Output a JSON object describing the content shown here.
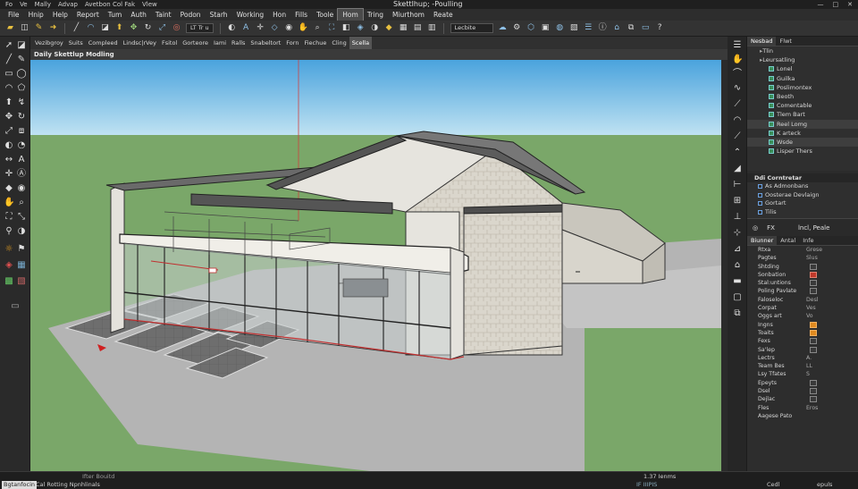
{
  "titlebar": {
    "menu": [
      "Fo",
      "Ve",
      "Mally",
      "Advap",
      "Avetbon Col Fak",
      "Vlew"
    ],
    "title": "Skettlhup; -Poulling",
    "controls": [
      "—",
      "□",
      "✕"
    ]
  },
  "menubar": [
    "File",
    "Hnip",
    "Help",
    "Report",
    "Tum",
    "Auth",
    "Taint",
    "Podon",
    "Starh",
    "Working",
    "Hon",
    "Fills",
    "Toole",
    "Hom",
    "Tring",
    "Miurthom",
    "Reate"
  ],
  "menubar_active_index": 13,
  "toolbar1": {
    "icons": [
      "folder-icon",
      "save-icon",
      "pencil-icon",
      "arrow-icon",
      "line-icon",
      "arc-icon",
      "eraser-icon",
      "push-pull-icon",
      "move-icon",
      "rotate-icon",
      "scale-icon",
      "offset-icon",
      "tape-icon",
      "text-icon",
      "axes-icon",
      "section-icon"
    ],
    "field1": "LT Tr u",
    "field2": "Lecbite"
  },
  "toolbar2": {
    "items": [
      "Vezibgroy",
      "Suits",
      "Compleed",
      "Lindsc|rVey",
      "Fsitol",
      "Gorteore",
      "Iami",
      "Ralls",
      "Snabeltort",
      "Forn",
      "Fiechue",
      "Cling",
      "Scella"
    ],
    "selected_index": 12
  },
  "viewport": {
    "title": "Daily Skettlup Modling"
  },
  "outliner": {
    "tabs": [
      "Nesbad",
      "Flwt"
    ],
    "rows": [
      {
        "label": "Tlin",
        "indent": 1,
        "check": false,
        "hl": false
      },
      {
        "label": "Leursatling",
        "indent": 1,
        "check": false,
        "hl": false
      },
      {
        "label": "Lonel",
        "indent": 2,
        "check": true,
        "hl": false
      },
      {
        "label": "Guilka",
        "indent": 2,
        "check": true,
        "hl": false
      },
      {
        "label": "Poslimontex",
        "indent": 2,
        "check": true,
        "hl": false
      },
      {
        "label": "Beoth",
        "indent": 2,
        "check": true,
        "hl": false
      },
      {
        "label": "Comentable",
        "indent": 2,
        "check": true,
        "hl": false
      },
      {
        "label": "Tlem Bart",
        "indent": 2,
        "check": true,
        "hl": false
      },
      {
        "label": "Reel Lomg",
        "indent": 2,
        "check": true,
        "hl": true
      },
      {
        "label": "K arteck",
        "indent": 2,
        "check": true,
        "hl": false
      },
      {
        "label": "Wsde",
        "indent": 2,
        "check": true,
        "hl": true
      },
      {
        "label": "Lisper Thers",
        "indent": 2,
        "check": true,
        "hl": false
      }
    ]
  },
  "components": {
    "title": "Ddi Corntretar",
    "rows": [
      "As Admonbans",
      "Oosterae Devlaign",
      "Gortart",
      "Tilis"
    ]
  },
  "fxbar": {
    "fx": "FX",
    "right": "lncl, Peale"
  },
  "props": {
    "tabs": [
      "Biunner",
      "Antal",
      "Infe"
    ],
    "rows": [
      {
        "label": "Rtxa",
        "value": "Grese",
        "mark": ""
      },
      {
        "label": "Pagtes",
        "value": "Slus",
        "mark": ""
      },
      {
        "label": "Shtding",
        "value": "",
        "mark": "box"
      },
      {
        "label": "Sonbation",
        "value": "",
        "mark": "r"
      },
      {
        "label": "Stal:untions",
        "value": "",
        "mark": "box"
      },
      {
        "label": "Poling Pavlate",
        "value": "",
        "mark": "box"
      },
      {
        "label": "Faloseloc",
        "value": "Desl",
        "mark": ""
      },
      {
        "label": "Corpat",
        "value": "Ves",
        "mark": ""
      },
      {
        "label": "Oggs art",
        "value": "Vo",
        "mark": ""
      },
      {
        "label": "Ingns",
        "value": "",
        "mark": "o"
      },
      {
        "label": "Toaits",
        "value": "",
        "mark": "o"
      },
      {
        "label": "Fexs",
        "value": "",
        "mark": "box"
      },
      {
        "label": "Sa'lep",
        "value": "",
        "mark": "box"
      },
      {
        "label": "Lectrs",
        "value": "A.",
        "mark": ""
      },
      {
        "label": "Team Bes",
        "value": "LL",
        "mark": ""
      },
      {
        "label": "Lsy Tfates",
        "value": "S",
        "mark": ""
      },
      {
        "label": "Epeyts",
        "value": "",
        "mark": "box"
      },
      {
        "label": "Dsel",
        "value": "",
        "mark": "box"
      },
      {
        "label": "Dejlac",
        "value": "",
        "mark": "box"
      },
      {
        "label": "Fles",
        "value": "Eros",
        "mark": ""
      },
      {
        "label": "Aagese Pato",
        "value": "",
        "mark": ""
      }
    ]
  },
  "statusbar": {
    "left_tag": "Bgtanfocin",
    "left_text": "Cal Rotting Npnhlinals",
    "left_hint": "Ifter Bouitd",
    "items": "1.37 Ienms",
    "mid": "IF IIIPIS",
    "right1": "Cedl",
    "right2": "epuls"
  }
}
